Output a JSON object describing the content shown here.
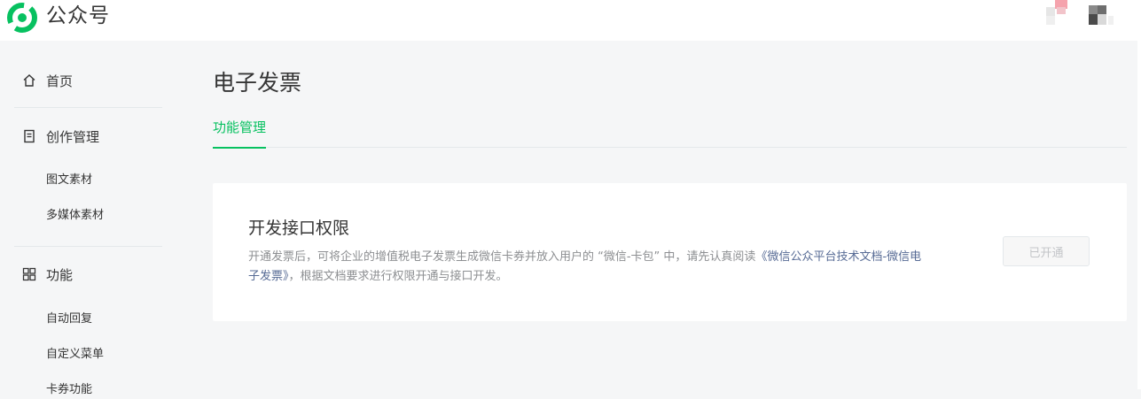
{
  "header": {
    "brand": "公众号",
    "logo_icon": "wechat-official-account-logo-icon",
    "accent": "#07c160"
  },
  "sidebar": {
    "items": [
      {
        "label": "首页",
        "icon": "home-icon"
      },
      {
        "label": "创作管理",
        "icon": "document-icon",
        "children": [
          "图文素材",
          "多媒体素材"
        ]
      },
      {
        "label": "功能",
        "icon": "grid-icon",
        "children": [
          "自动回复",
          "自定义菜单",
          "卡券功能"
        ]
      }
    ]
  },
  "main": {
    "title": "电子发票",
    "tabs": [
      {
        "label": "功能管理",
        "active": true
      }
    ],
    "card": {
      "title": "开发接口权限",
      "desc_before": "开通发票后，可将企业的增值税电子发票生成微信卡券并放入用户的 “微信-卡包” 中，请先认真阅读",
      "desc_link": "《微信公众平台技术文档-微信电子发票》",
      "desc_after": "，根据文档要求进行权限开通与接口开发。",
      "status_button": "已开通"
    }
  }
}
